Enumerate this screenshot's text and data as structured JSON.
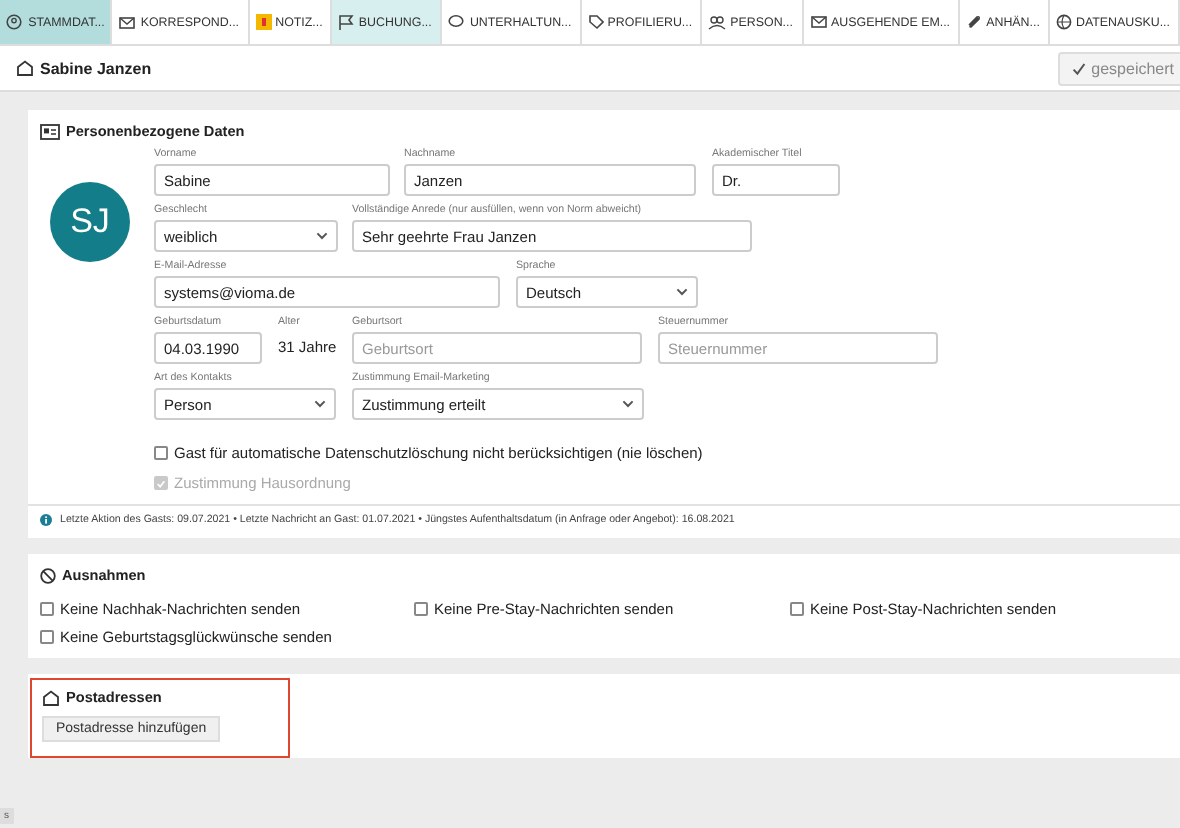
{
  "tabs": [
    {
      "label": "STAMMDAT...",
      "selected": true,
      "highlighted": false
    },
    {
      "label": "KORRESPOND...",
      "selected": false,
      "highlighted": false
    },
    {
      "label": "NOTIZ...",
      "selected": false,
      "highlighted": false
    },
    {
      "label": "BUCHUNG...",
      "selected": false,
      "highlighted": true
    },
    {
      "label": "UNTERHALTUN...",
      "selected": false,
      "highlighted": false
    },
    {
      "label": "PROFILIERU...",
      "selected": false,
      "highlighted": false
    },
    {
      "label": "PERSON...",
      "selected": false,
      "highlighted": false
    },
    {
      "label": "AUSGEHENDE EM...",
      "selected": false,
      "highlighted": false
    },
    {
      "label": "ANHÄN...",
      "selected": false,
      "highlighted": false
    },
    {
      "label": "DATENAUSKU...",
      "selected": false,
      "highlighted": false
    }
  ],
  "header": {
    "title": "Sabine Janzen",
    "save_button": "gespeichert"
  },
  "personal": {
    "title": "Personenbezogene Daten",
    "avatar_initials": "SJ",
    "fields": [
      {
        "kind": "text",
        "label": "Vorname",
        "value": "Sabine"
      },
      {
        "kind": "text",
        "label": "Nachname",
        "value": "Janzen"
      },
      {
        "kind": "text",
        "label": "Akademischer Titel",
        "value": "Dr."
      },
      {
        "kind": "select",
        "label": "Geschlecht",
        "value": "weiblich"
      },
      {
        "kind": "text",
        "label": "Vollständige Anrede (nur ausfüllen, wenn von Norm abweicht)",
        "value": "Sehr geehrte Frau Janzen"
      },
      {
        "kind": "text",
        "label": "E-Mail-Adresse",
        "value": "systems@vioma.de"
      },
      {
        "kind": "select",
        "label": "Sprache",
        "value": "Deutsch"
      },
      {
        "kind": "text",
        "label": "Geburtsdatum",
        "value": "04.03.1990"
      },
      {
        "kind": "static",
        "label": "Alter",
        "value": "31 Jahre"
      },
      {
        "kind": "text",
        "label": "Geburtsort",
        "placeholder": "Geburtsort"
      },
      {
        "kind": "text",
        "label": "Steuernummer",
        "placeholder": "Steuernummer"
      },
      {
        "kind": "select",
        "label": "Art des Kontakts",
        "value": "Person"
      },
      {
        "kind": "select",
        "label": "Zustimmung Email-Marketing",
        "value": "Zustimmung erteilt"
      }
    ],
    "checkboxes": [
      {
        "label": "Gast für automatische Datenschutzlöschung nicht berücksichtigen (nie löschen)",
        "checked": false,
        "disabled": false
      },
      {
        "label": "Zustimmung Hausordnung",
        "checked": true,
        "disabled": true
      }
    ],
    "info": "Letzte Aktion des Gasts: 09.07.2021  •  Letzte Nachricht an Gast: 01.07.2021  •  Jüngstes Aufenthaltsdatum (in Anfrage oder Angebot): 16.08.2021"
  },
  "exceptions": {
    "title": "Ausnahmen",
    "options": [
      {
        "label": "Keine Nachhak-Nachrichten senden",
        "checked": false
      },
      {
        "label": "Keine Pre-Stay-Nachrichten senden",
        "checked": false
      },
      {
        "label": "Keine Post-Stay-Nachrichten senden",
        "checked": false
      },
      {
        "label": "Keine Geburtstagsglückwünsche senden",
        "checked": false
      }
    ]
  },
  "postal": {
    "title": "Postadressen",
    "highlighted": true,
    "add_button": "Postadresse hinzufügen"
  },
  "edge_tab": "s"
}
